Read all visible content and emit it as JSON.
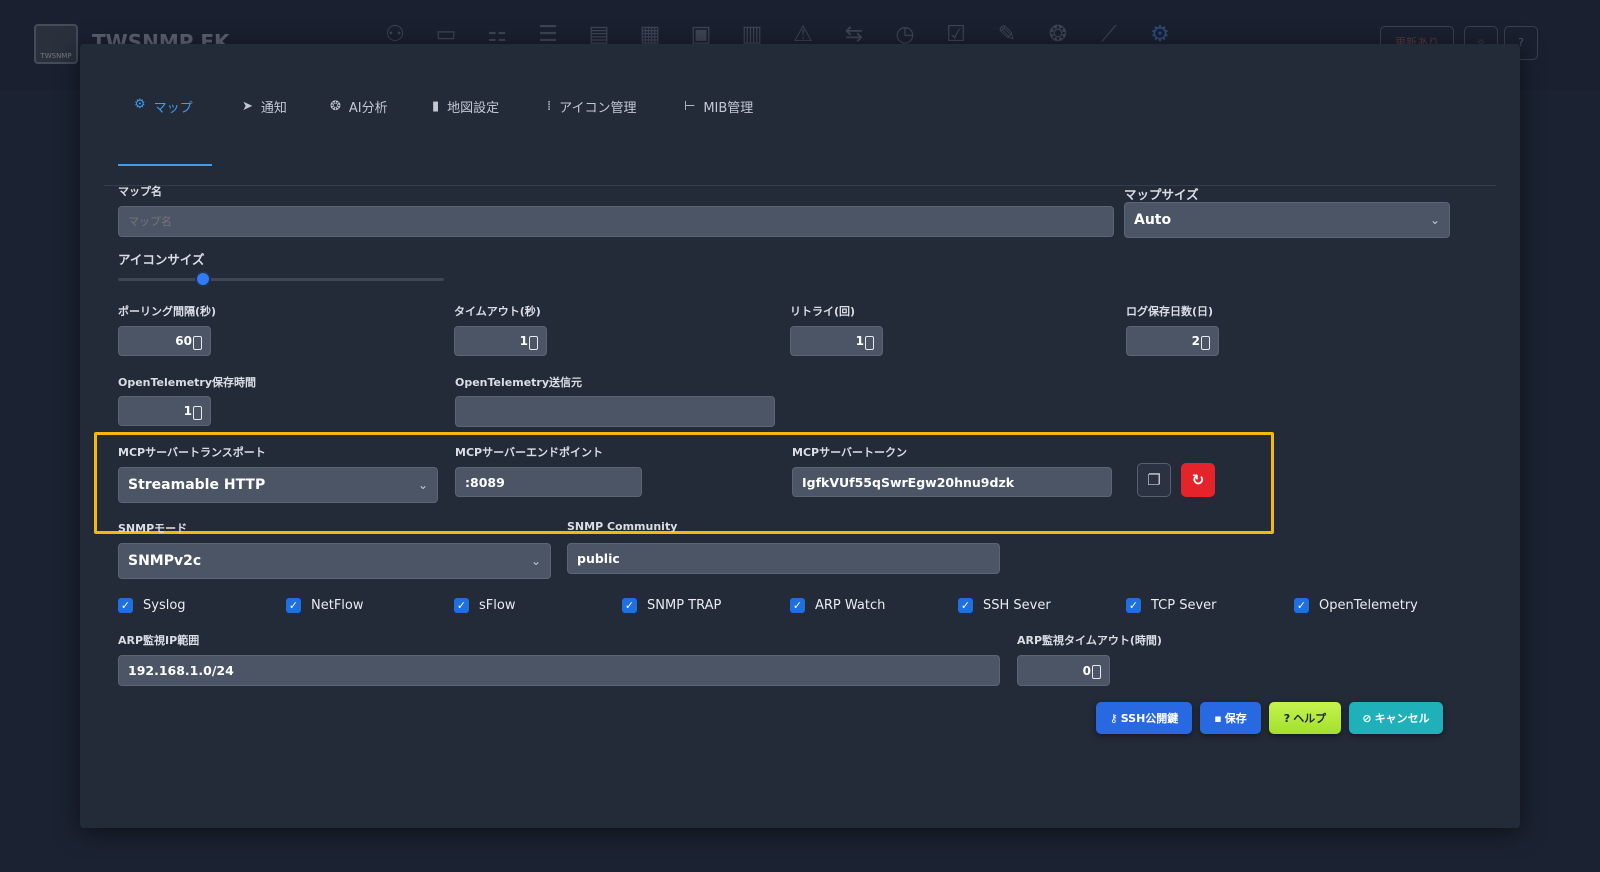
{
  "app": {
    "title": "TWSNMP FK",
    "logo_text": "TWSNMP",
    "right_button": "更新あり"
  },
  "tabs": [
    {
      "label": "マップ",
      "icon": "gear-icon"
    },
    {
      "label": "通知",
      "icon": "send-icon"
    },
    {
      "label": "AI分析",
      "icon": "brain-icon"
    },
    {
      "label": "地図設定",
      "icon": "map-icon"
    },
    {
      "label": "アイコン管理",
      "icon": "grid-icon"
    },
    {
      "label": "MIB管理",
      "icon": "tree-icon"
    }
  ],
  "form": {
    "map_name": {
      "label": "マップ名",
      "placeholder": "マップ名",
      "value": ""
    },
    "map_size": {
      "label": "マップサイズ",
      "value": "Auto"
    },
    "icon_size": {
      "label": "アイコンサイズ",
      "level": 0.26
    },
    "polling_interval": {
      "label": "ポーリング間隔(秒)",
      "value": "60"
    },
    "timeout": {
      "label": "タイムアウト(秒)",
      "value": "1"
    },
    "retry": {
      "label": "リトライ(回)",
      "value": "1"
    },
    "log_days": {
      "label": "ログ保存日数(日)",
      "value": "2"
    },
    "otel_retention": {
      "label": "OpenTelemetry保存時間",
      "value": "1"
    },
    "otel_source": {
      "label": "OpenTelemetry送信元",
      "value": ""
    },
    "mcp_transport": {
      "label": "MCPサーバートランスポート",
      "value": "Streamable HTTP"
    },
    "mcp_endpoint": {
      "label": "MCPサーバーエンドポイント",
      "value": ":8089"
    },
    "mcp_token": {
      "label": "MCPサーバートークン",
      "value": "IgfkVUf55qSwrEgw20hnu9dzk"
    },
    "snmp_mode": {
      "label": "SNMPモード",
      "value": "SNMPv2c"
    },
    "snmp_community": {
      "label": "SNMP Community",
      "value": "public"
    },
    "arp_range": {
      "label": "ARP監視IP範囲",
      "value": "192.168.1.0/24"
    },
    "arp_timeout": {
      "label": "ARP監視タイムアウト(時間)",
      "value": "0"
    }
  },
  "checkboxes": [
    {
      "label": "Syslog",
      "checked": true
    },
    {
      "label": "NetFlow",
      "checked": true
    },
    {
      "label": "sFlow",
      "checked": true
    },
    {
      "label": "SNMP TRAP",
      "checked": true
    },
    {
      "label": "ARP Watch",
      "checked": true
    },
    {
      "label": "SSH Sever",
      "checked": true
    },
    {
      "label": "TCP Sever",
      "checked": true
    },
    {
      "label": "OpenTelemetry",
      "checked": true
    }
  ],
  "buttons": {
    "ssh": "SSH公開鍵",
    "save": "保存",
    "help": "ヘルプ",
    "cancel": "キャンセル"
  },
  "colors": {
    "accent": "#3b9cf0",
    "highlight": "#f5b80d",
    "danger": "#e5232b",
    "help": "#b6f23e",
    "cancel": "#1fb0b9"
  }
}
